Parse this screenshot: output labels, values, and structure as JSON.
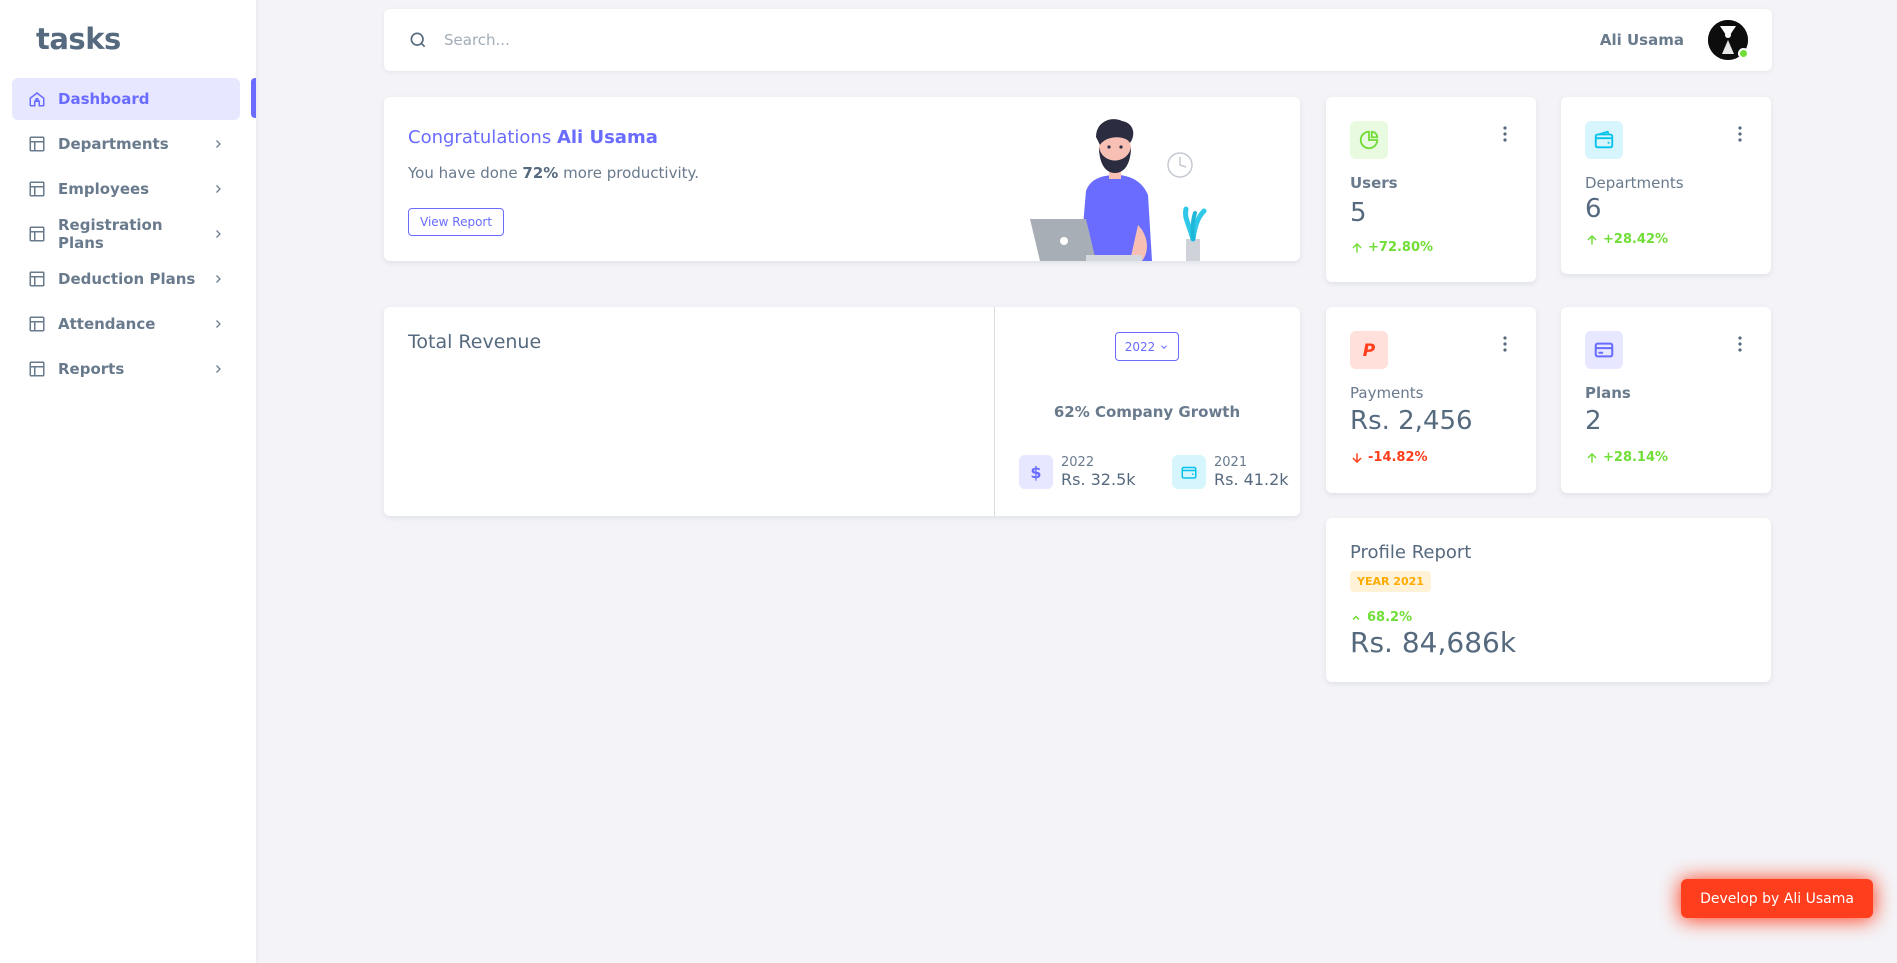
{
  "sidebar": {
    "brand": "tasks",
    "items": [
      {
        "label": "Dashboard",
        "active": true
      },
      {
        "label": "Departments"
      },
      {
        "label": "Employees"
      },
      {
        "label": "Registration Plans"
      },
      {
        "label": "Deduction Plans"
      },
      {
        "label": "Attendance"
      },
      {
        "label": "Reports"
      }
    ]
  },
  "navbar": {
    "search_placeholder": "Search...",
    "user_name": "Ali Usama"
  },
  "welcome": {
    "title_prefix": "Congratulations",
    "title_name": "Ali Usama",
    "subtitle_prefix": "You have done",
    "subtitle_value": "72%",
    "subtitle_suffix": "more productivity.",
    "button_label": "View Report"
  },
  "stats": {
    "users": {
      "label": "Users",
      "value": "5",
      "change": "+72.80%",
      "color": "#71dd37"
    },
    "departments": {
      "label": "Departments",
      "value": "6",
      "change": "+28.42%",
      "color": "#03c3ec"
    },
    "payments": {
      "label": "Payments",
      "value": "Rs. 2,456",
      "change": "-14.82%",
      "color": "#ff3e1d"
    },
    "plans": {
      "label": "Plans",
      "value": "2",
      "change": "+28.14%",
      "color": "#696cff"
    }
  },
  "revenue": {
    "title": "Total Revenue",
    "year_select": "2022",
    "growth_text": "62% Company Growth",
    "items": [
      {
        "year": "2022",
        "value": "Rs. 32.5k"
      },
      {
        "year": "2021",
        "value": "Rs. 41.2k"
      }
    ]
  },
  "profile_report": {
    "title": "Profile Report",
    "badge": "YEAR 2021",
    "change": "68.2%",
    "value": "Rs. 84,686k"
  },
  "dev_button": "Develop by Ali Usama",
  "colors": {
    "primary": "#696cff",
    "success": "#71dd37",
    "danger": "#ff3e1d",
    "info": "#03c3ec",
    "warning": "#ffab00"
  }
}
